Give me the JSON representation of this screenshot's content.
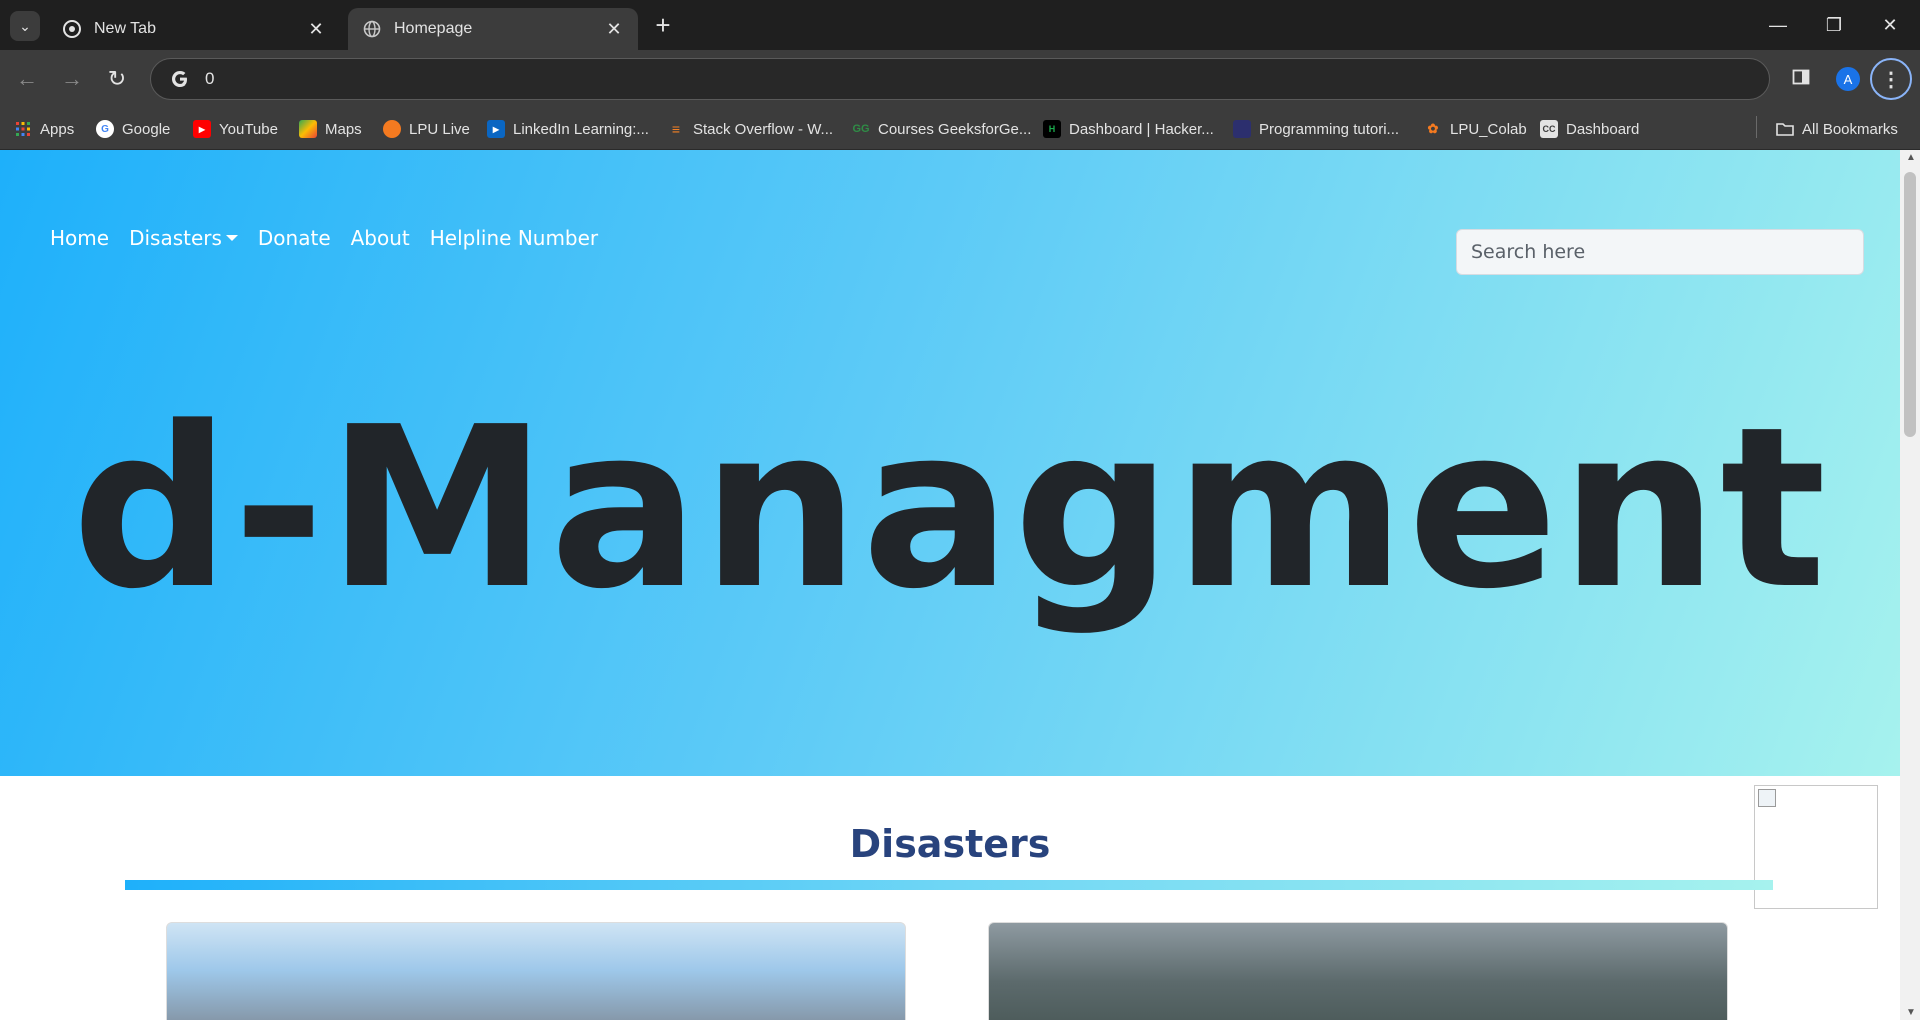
{
  "browser": {
    "tabs": [
      {
        "title": "New Tab",
        "active": false
      },
      {
        "title": "Homepage",
        "active": true
      }
    ],
    "address_value": "0",
    "profile_initial": "A",
    "bookmarks": [
      {
        "label": "Apps",
        "icon": "apps-grid-icon"
      },
      {
        "label": "Google",
        "icon": "google-icon"
      },
      {
        "label": "YouTube",
        "icon": "youtube-icon"
      },
      {
        "label": "Maps",
        "icon": "maps-icon"
      },
      {
        "label": "LPU Live",
        "icon": "lpu-live-icon"
      },
      {
        "label": "LinkedIn Learning:...",
        "icon": "linkedin-learning-icon"
      },
      {
        "label": "Stack Overflow - W...",
        "icon": "stackoverflow-icon"
      },
      {
        "label": "Courses GeeksforGe...",
        "icon": "geeksforgeeks-icon"
      },
      {
        "label": "Dashboard | Hacker...",
        "icon": "hackerrank-icon"
      },
      {
        "label": "Programming tutori...",
        "icon": "programming-icon"
      },
      {
        "label": "LPU_Colab",
        "icon": "lpu-colab-icon"
      },
      {
        "label": "Dashboard",
        "icon": "cc-dashboard-icon"
      }
    ],
    "all_bookmarks": "All Bookmarks"
  },
  "page": {
    "nav": {
      "home": "Home",
      "disasters": "Disasters",
      "donate": "Donate",
      "about": "About",
      "helpline": "Helpline Number"
    },
    "search_placeholder": "Search here",
    "hero_title": "d-Managment",
    "section_title": "Disasters"
  },
  "colors": {
    "hero_gradient_start": "#1eb0fa",
    "hero_gradient_end": "#a6f2ee",
    "section_title": "#28437d"
  }
}
